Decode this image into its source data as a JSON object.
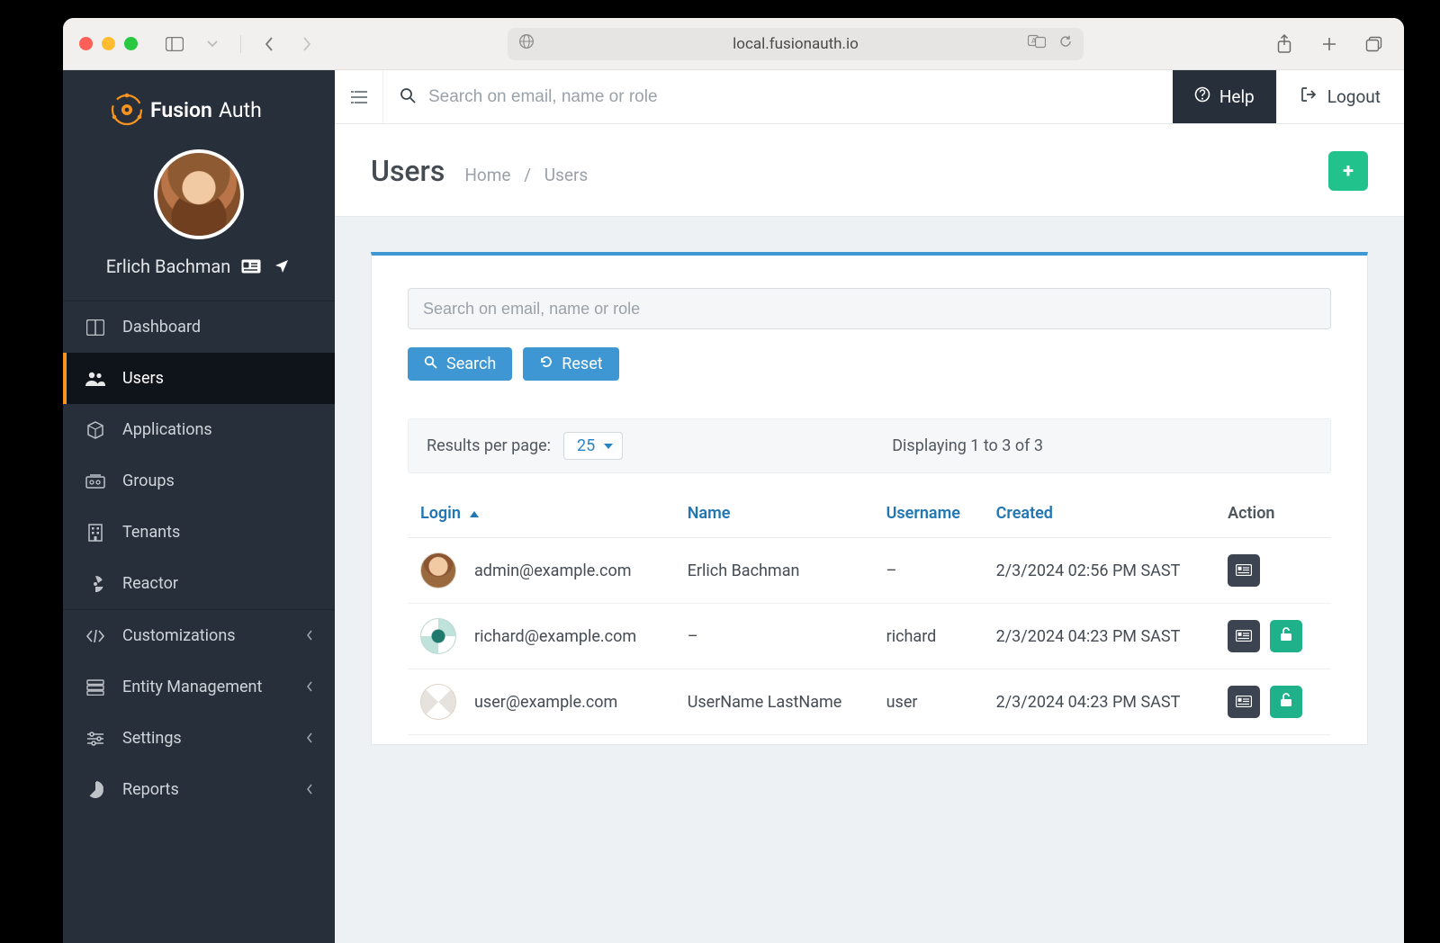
{
  "browser": {
    "url": "local.fusionauth.io"
  },
  "brand": {
    "name1": "Fusion",
    "name2": "Auth"
  },
  "profile": {
    "name": "Erlich Bachman"
  },
  "sidebar": {
    "items": [
      {
        "label": "Dashboard"
      },
      {
        "label": "Users"
      },
      {
        "label": "Applications"
      },
      {
        "label": "Groups"
      },
      {
        "label": "Tenants"
      },
      {
        "label": "Reactor"
      },
      {
        "label": "Customizations"
      },
      {
        "label": "Entity Management"
      },
      {
        "label": "Settings"
      },
      {
        "label": "Reports"
      }
    ]
  },
  "topbar": {
    "search_placeholder": "Search on email, name or role",
    "help_label": "Help",
    "logout_label": "Logout"
  },
  "header": {
    "title": "Users",
    "crumb_home": "Home",
    "crumb_current": "Users"
  },
  "panel": {
    "search_placeholder": "Search on email, name or role",
    "search_btn": "Search",
    "reset_btn": "Reset",
    "results_label": "Results per page:",
    "results_value": "25",
    "display_text": "Displaying 1 to 3 of 3"
  },
  "table": {
    "head": {
      "login": "Login",
      "name": "Name",
      "username": "Username",
      "created": "Created",
      "action": "Action"
    },
    "rows": [
      {
        "login": "admin@example.com",
        "name": "Erlich Bachman",
        "username": "–",
        "created": "2/3/2024 02:56 PM SAST"
      },
      {
        "login": "richard@example.com",
        "name": "–",
        "username": "richard",
        "created": "2/3/2024 04:23 PM SAST"
      },
      {
        "login": "user@example.com",
        "name": "UserName LastName",
        "username": "user",
        "created": "2/3/2024 04:23 PM SAST"
      }
    ]
  }
}
